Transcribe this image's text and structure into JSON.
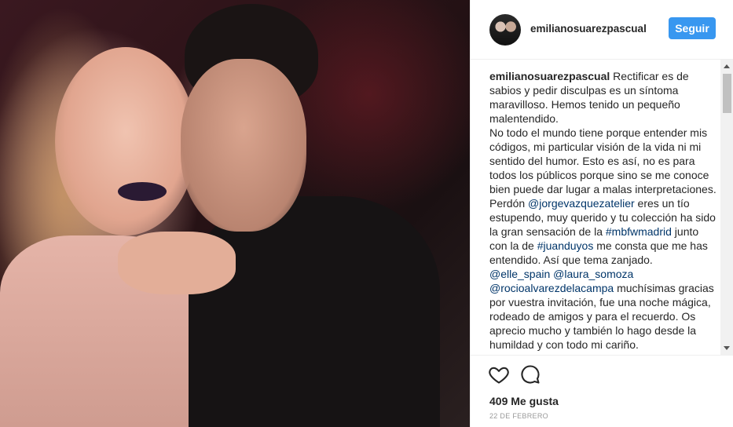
{
  "post": {
    "username": "emilianosuarezpascual",
    "follow_label": "Seguir",
    "caption_parts": [
      {
        "type": "user",
        "text": "emilianosuarezpascual"
      },
      {
        "type": "text",
        "text": " Rectificar es de sabios y pedir disculpas es un síntoma maravilloso. Hemos tenido un pequeño malentendido."
      }
    ],
    "para2": "No todo el mundo tiene porque entender mis códigos, mi particular visión de la vida ni mi sentido del humor. Esto es así, no es para todos los públicos porque sino se me conoce bien puede dar lugar a malas interpretaciones.",
    "para3": {
      "t1": "Perdón ",
      "m1": "@jorgevazquezatelier",
      "t2": " eres un tío estupendo, muy querido y tu colección ha sido la gran sensación de la ",
      "h1": "#mbfwmadrid",
      "t3": " junto con la de ",
      "h2": "#juanduyos",
      "t4": " me consta que me has entendido. Así que tema zanjado."
    },
    "para4": {
      "m1": "@elle_spain",
      "m2": "@laura_somoza",
      "m3": "@rocioalvarezdelacampa",
      "t1": " muchísimas gracias por vuestra invitación, fue una noche mágica, rodeado de amigos y para el recuerdo. Os aprecio mucho y también lo hago desde la humildad y con todo mi cariño."
    },
    "likes": "409 Me gusta",
    "date": "22 de febrero"
  },
  "icons": {
    "like": "heart-icon",
    "comment": "comment-icon"
  }
}
